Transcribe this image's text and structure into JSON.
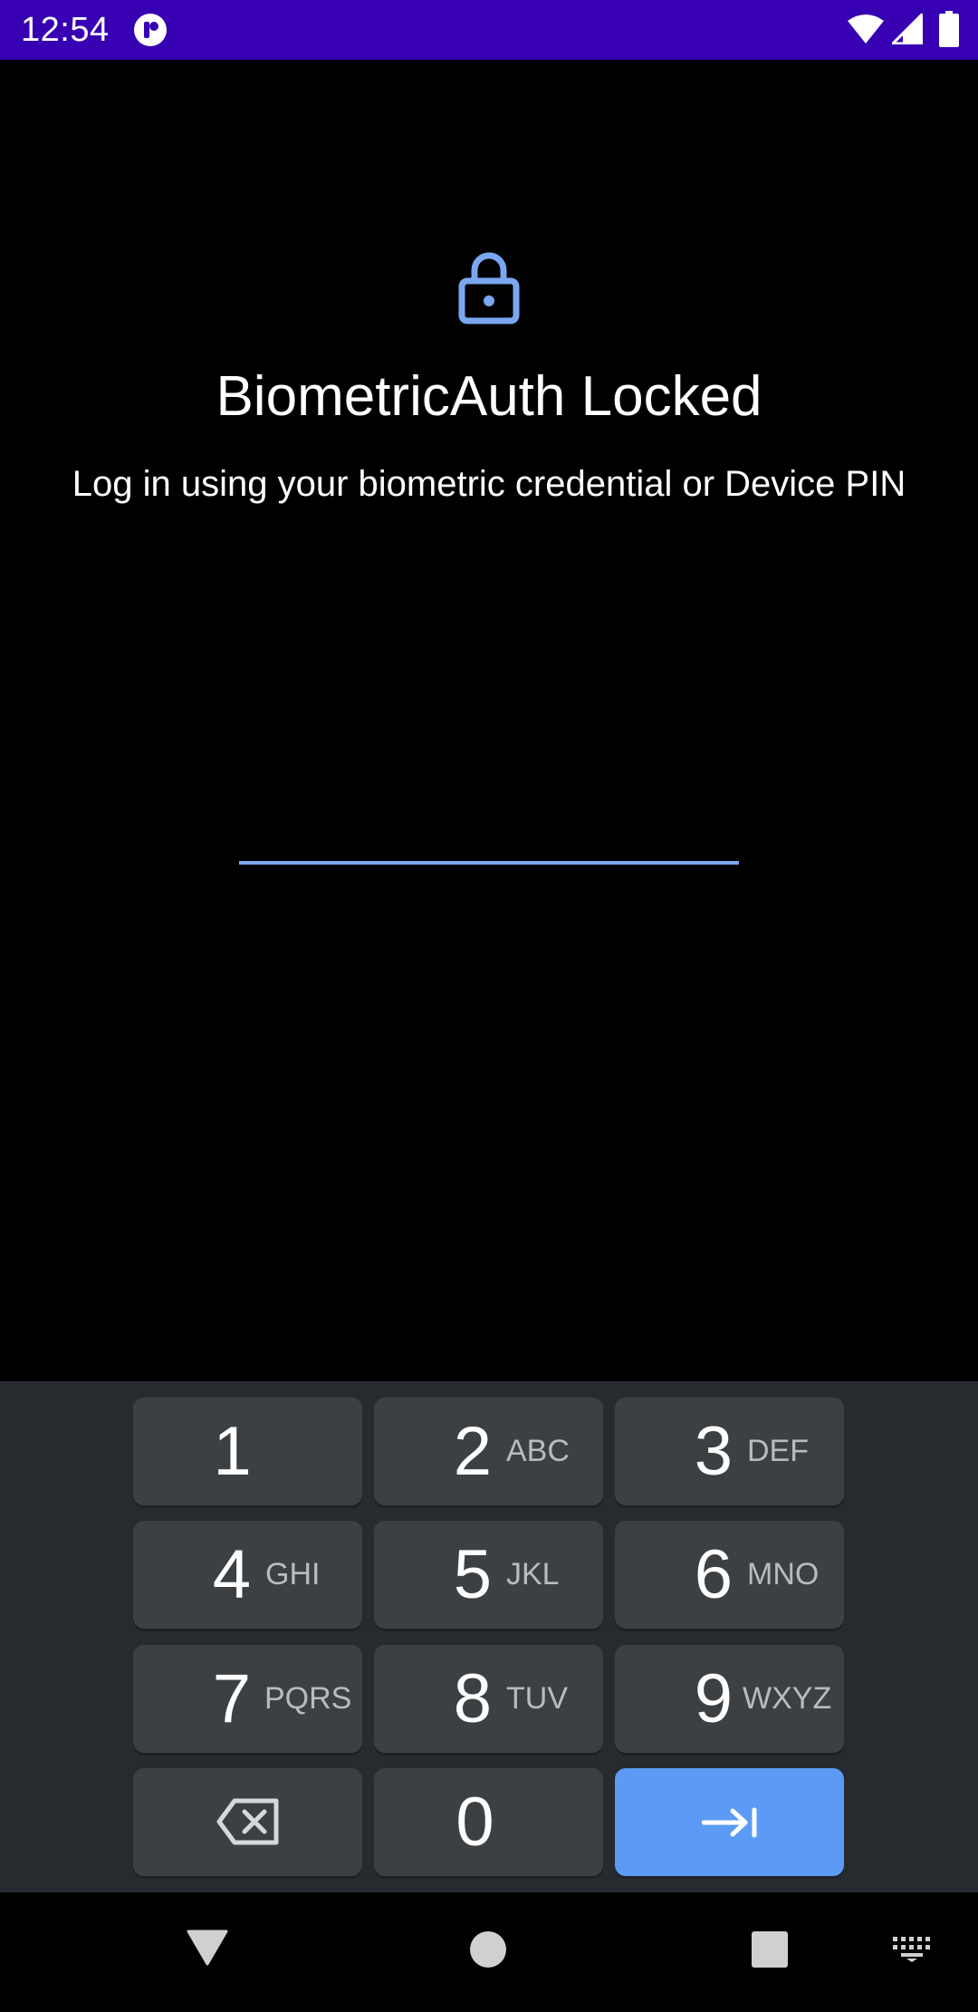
{
  "status_bar": {
    "time": "12:54",
    "background": "#3700b3",
    "icons": [
      "app-notification-icon",
      "wifi-icon",
      "signal-icon",
      "battery-icon"
    ]
  },
  "lock_screen": {
    "icon": "lock-icon",
    "accent_color": "#7aa7f0",
    "title": "BiometricAuth Locked",
    "subtitle": "Log in using your biometric credential or Device PIN",
    "pin_value": ""
  },
  "keypad": {
    "keys": [
      {
        "digit": "1",
        "letters": ""
      },
      {
        "digit": "2",
        "letters": "ABC"
      },
      {
        "digit": "3",
        "letters": "DEF"
      },
      {
        "digit": "4",
        "letters": "GHI"
      },
      {
        "digit": "5",
        "letters": "JKL"
      },
      {
        "digit": "6",
        "letters": "MNO"
      },
      {
        "digit": "7",
        "letters": "PQRS"
      },
      {
        "digit": "8",
        "letters": "TUV"
      },
      {
        "digit": "9",
        "letters": "WXYZ"
      },
      {
        "digit": "0",
        "letters": ""
      }
    ],
    "backspace_icon": "backspace-icon",
    "enter_icon": "tab-next-icon",
    "enter_color": "#5c9bf5"
  },
  "nav_bar": {
    "icons": [
      "back-triangle-icon",
      "home-circle-icon",
      "recents-square-icon",
      "keyboard-icon"
    ]
  }
}
